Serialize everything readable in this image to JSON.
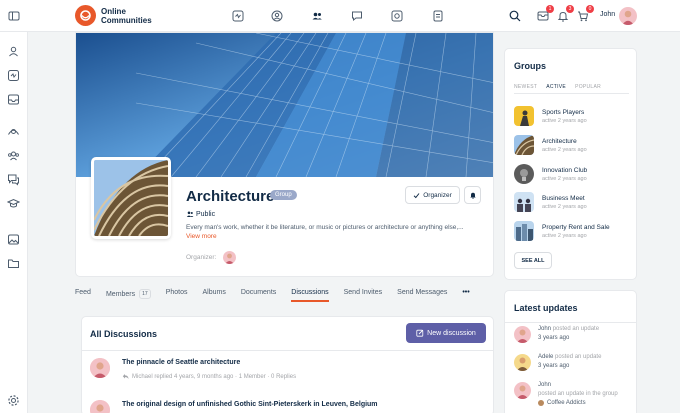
{
  "brand": {
    "name": "Online Communities"
  },
  "topnav": {
    "icons": [
      "activity-icon",
      "profile-icon",
      "members-icon",
      "forums-icon",
      "photos-icon",
      "documents-icon"
    ]
  },
  "header": {
    "user_name": "John",
    "badges": {
      "messages": "1",
      "notifications": "3",
      "cart": "0"
    }
  },
  "group": {
    "title": "Architecture",
    "tag": "Group",
    "privacy": "Public",
    "description": "Every man's work, whether it be literature, or music or pictures or architecture or anything else,...",
    "view_more": "View more",
    "organizer_label": "Organizer:",
    "organizer_button": "Organizer"
  },
  "tabs": [
    {
      "label": "Feed"
    },
    {
      "label": "Members",
      "count": "17"
    },
    {
      "label": "Photos"
    },
    {
      "label": "Albums"
    },
    {
      "label": "Documents"
    },
    {
      "label": "Discussions"
    },
    {
      "label": "Send Invites"
    },
    {
      "label": "Send Messages"
    },
    {
      "label": "•••"
    }
  ],
  "discussions": {
    "title": "All Discussions",
    "new_button": "New discussion",
    "items": [
      {
        "title": "The pinnacle of Seattle architecture",
        "meta": "Michael replied 4 years, 9 months ago · 1 Member · 0 Replies"
      },
      {
        "title": "The original design of unfinished Gothic Sint-Pieterskerk in Leuven, Belgium",
        "meta": ""
      }
    ]
  },
  "groups_widget": {
    "title": "Groups",
    "filters": [
      "NEWEST",
      "ACTIVE",
      "POPULAR"
    ],
    "active_filter": "ACTIVE",
    "items": [
      {
        "name": "Sports Players",
        "time": "active 2 years ago",
        "color": "#f2c230"
      },
      {
        "name": "Architecture",
        "time": "active 2 years ago",
        "color": "#5a7fa3"
      },
      {
        "name": "Innovation Club",
        "time": "active 2 years ago",
        "color": "#6e6e6e"
      },
      {
        "name": "Business Meet",
        "time": "active 2 years ago",
        "color": "#9fc3e3"
      },
      {
        "name": "Property Rent and Sale",
        "time": "active 2 years ago",
        "color": "#4d6b8a"
      }
    ],
    "see_all": "SEE ALL"
  },
  "updates_widget": {
    "title": "Latest updates",
    "items": [
      {
        "name": "John",
        "action": "posted an update",
        "time": "3 years ago",
        "group": ""
      },
      {
        "name": "Adele",
        "action": "posted an update",
        "time": "3 years ago",
        "group": ""
      },
      {
        "name": "John",
        "action": "posted an update in the group",
        "time": "",
        "group": "Coffee Addicts"
      }
    ]
  }
}
